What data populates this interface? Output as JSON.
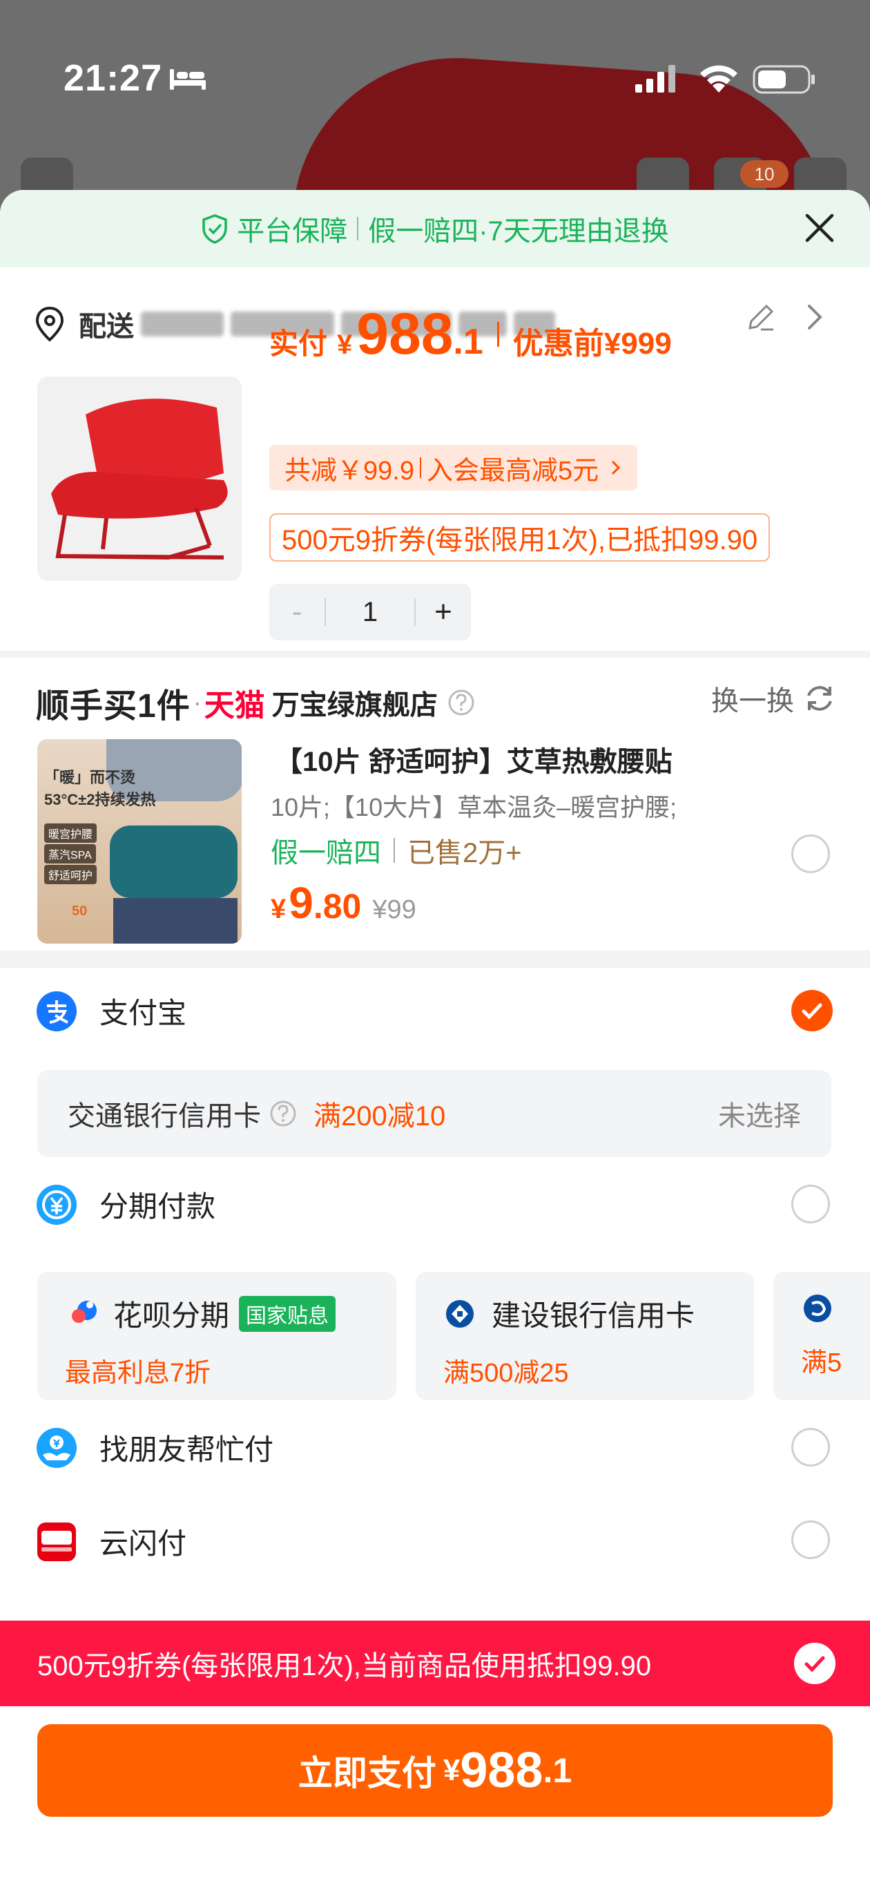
{
  "status_bar": {
    "time": "21:27"
  },
  "background_page": {
    "cart_count": "10"
  },
  "guarantee": {
    "prefix": "平台保障",
    "text": "假一赔四·7天无理由退换"
  },
  "address": {
    "label": "配送"
  },
  "product": {
    "price_label": "实付",
    "currency": "¥",
    "price_int": "988",
    "price_dec": ".1",
    "before_label": "优惠前",
    "before_price": "¥999",
    "discount_total": "共减￥99.9",
    "member_discount": "入会最高减5元",
    "coupon_text": "500元9折券(每张限用1次),已抵扣99.90",
    "quantity": "1",
    "minus": "-",
    "plus": "+"
  },
  "upsell": {
    "title": "顺手买1件",
    "platform": "天猫",
    "store": "万宝绿旗舰店",
    "swap_label": "换一换",
    "item_title": "【10片 舒适呵护】艾草热敷腰贴",
    "item_spec": "10片;【10大片】草本温灸–暖宫护腰;",
    "tag_guarantee": "假一赔四",
    "tag_sold": "已售2万+",
    "currency": "¥",
    "price_int": "9",
    "price_dec": ".80",
    "orig_price": "¥99",
    "img_text_1": "「暖」而不烫",
    "img_text_2": "53°C±2持续发热",
    "img_chip_1": "暖宫护腰",
    "img_chip_2": "蒸汽SPA",
    "img_chip_3": "舒适呵护",
    "img_badge": "50"
  },
  "payment": {
    "alipay": "支付宝",
    "bank_card": "交通银行信用卡",
    "bank_promo": "满200减10",
    "bank_unselected": "未选择",
    "installment": "分期付款",
    "huabei": "花呗分期",
    "huabei_badge": "国家贴息",
    "huabei_promo": "最高利息7折",
    "ccb": "建设银行信用卡",
    "ccb_promo": "满500减25",
    "third_promo": "满5",
    "friend_pay": "找朋友帮忙付",
    "unionpay": "云闪付"
  },
  "coupon_banner": {
    "text": "500元9折券(每张限用1次),当前商品使用抵扣99.90"
  },
  "pay_button": {
    "label": "立即支付",
    "currency": "¥",
    "amount_int": "988",
    "amount_dec": ".1"
  },
  "colors": {
    "accent": "#ff5000",
    "green": "#1bb35a",
    "banner": "#ff1744",
    "tmall": "#ff0036"
  }
}
